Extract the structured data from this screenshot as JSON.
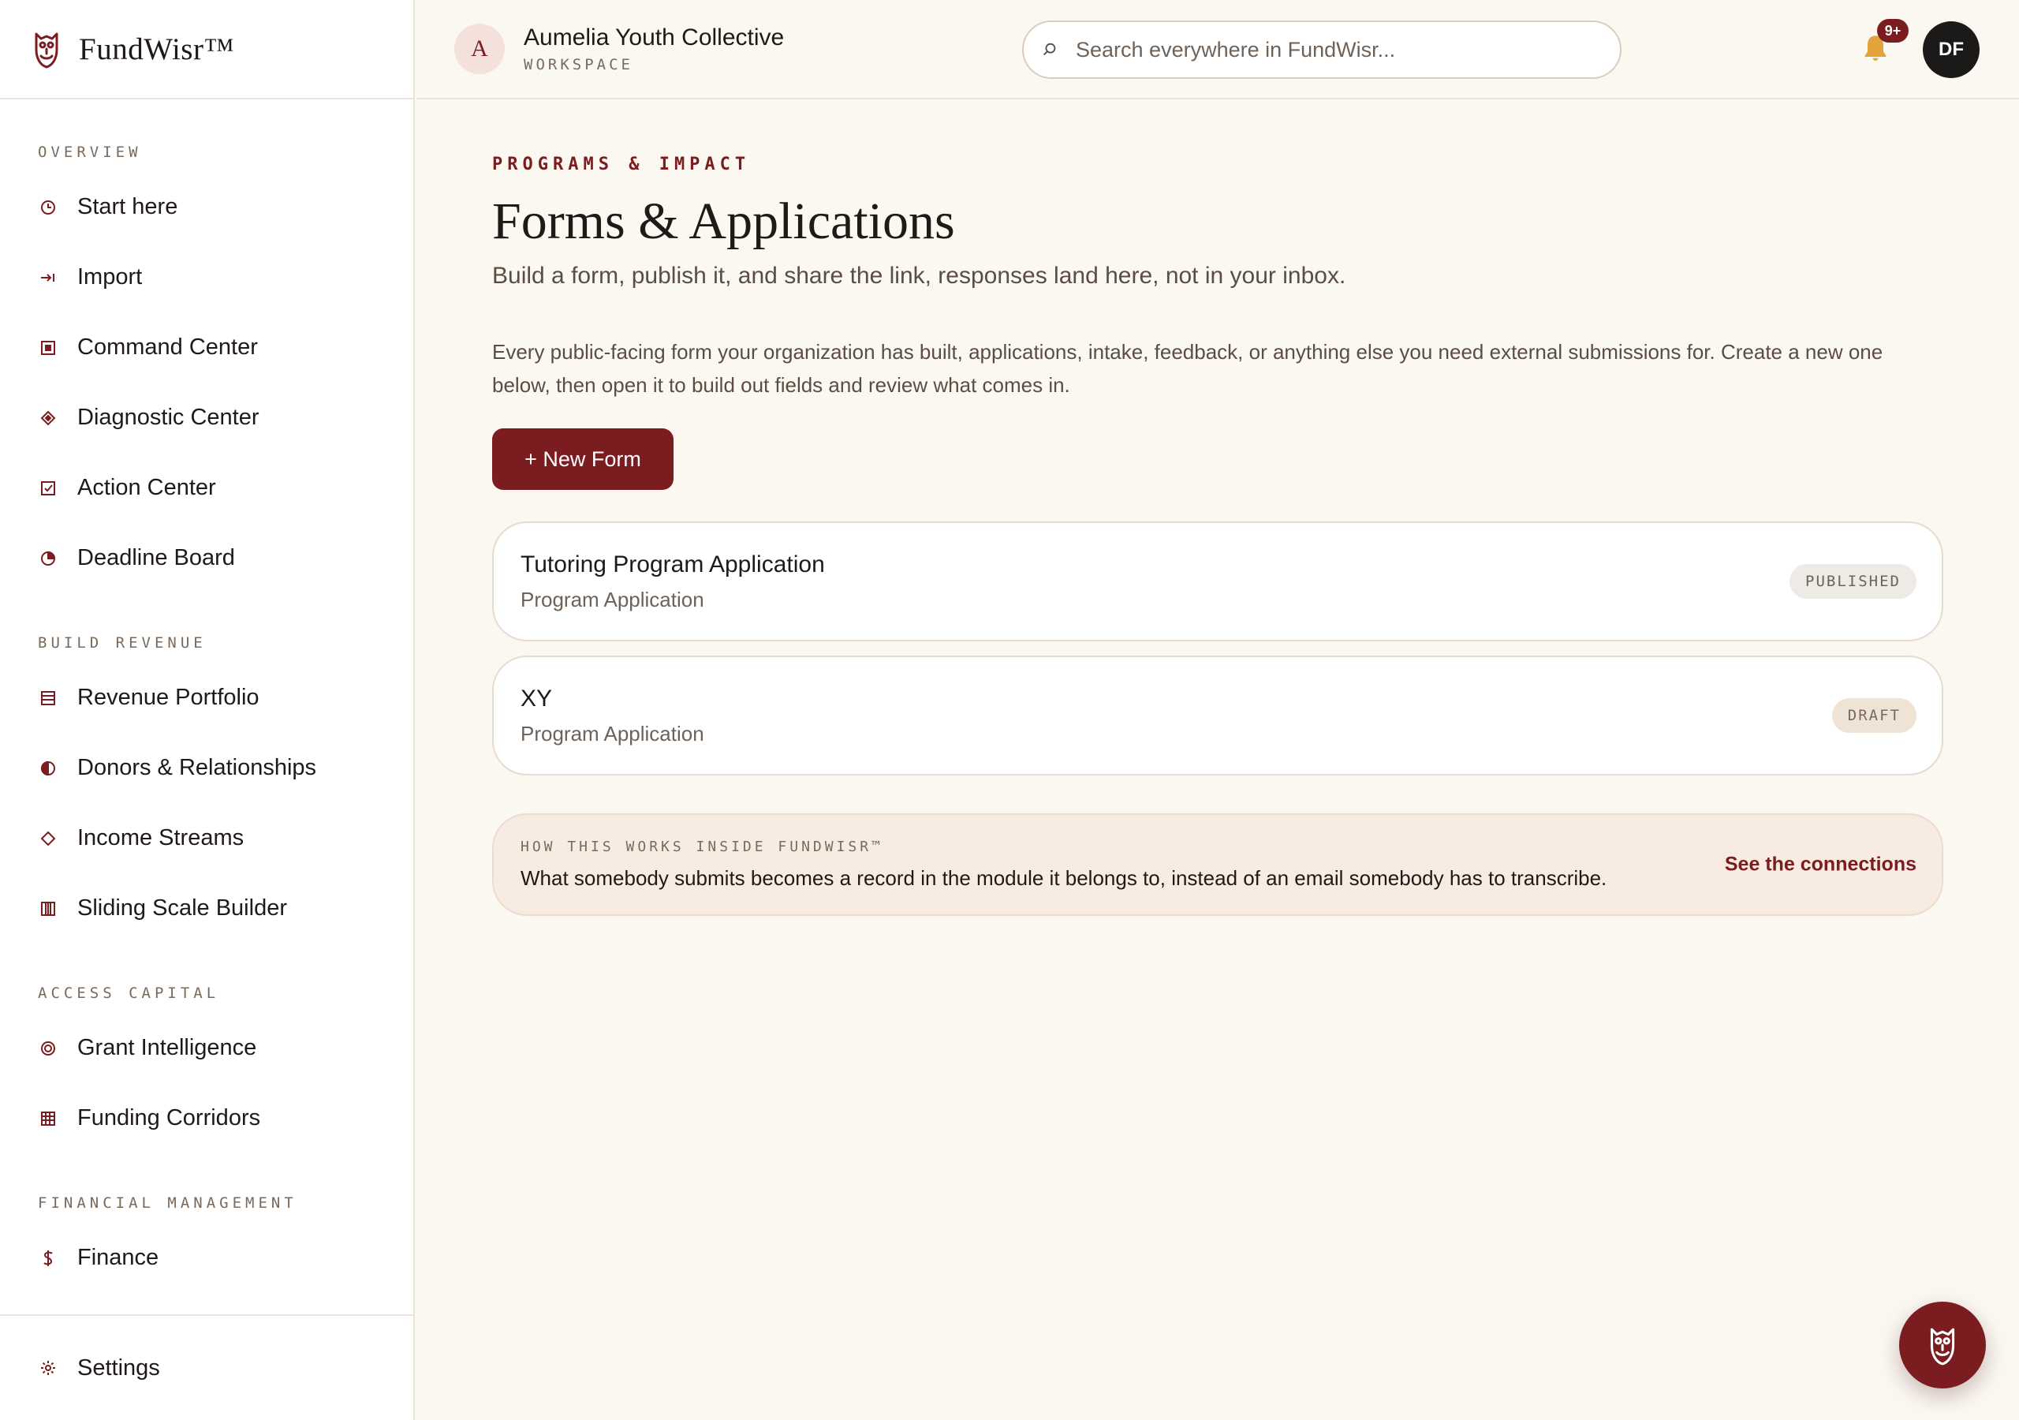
{
  "brand": {
    "name": "FundWisr™"
  },
  "workspace": {
    "initial": "A",
    "name": "Aumelia Youth Collective",
    "label": "WORKSPACE"
  },
  "search": {
    "placeholder": "Search everywhere in FundWisr..."
  },
  "notifications": {
    "badge": "9+"
  },
  "user": {
    "initials": "DF"
  },
  "sidebar": {
    "sections": [
      {
        "title": "OVERVIEW",
        "items": [
          {
            "label": "Start here",
            "icon": "clock-icon"
          },
          {
            "label": "Import",
            "icon": "import-arrow-icon"
          },
          {
            "label": "Command Center",
            "icon": "square-target-icon"
          },
          {
            "label": "Diagnostic Center",
            "icon": "diamond-icon"
          },
          {
            "label": "Action Center",
            "icon": "checkbox-icon"
          },
          {
            "label": "Deadline Board",
            "icon": "pie-icon"
          }
        ]
      },
      {
        "title": "BUILD REVENUE",
        "items": [
          {
            "label": "Revenue Portfolio",
            "icon": "list-icon"
          },
          {
            "label": "Donors & Relationships",
            "icon": "half-circle-icon"
          },
          {
            "label": "Income Streams",
            "icon": "diamond-outline-icon"
          },
          {
            "label": "Sliding Scale Builder",
            "icon": "columns-icon"
          }
        ]
      },
      {
        "title": "ACCESS CAPITAL",
        "items": [
          {
            "label": "Grant Intelligence",
            "icon": "target-icon"
          },
          {
            "label": "Funding Corridors",
            "icon": "grid-icon"
          }
        ]
      },
      {
        "title": "FINANCIAL MANAGEMENT",
        "items": [
          {
            "label": "Finance",
            "icon": "dollar-icon"
          }
        ]
      }
    ],
    "settings": {
      "label": "Settings",
      "icon": "gear-icon"
    }
  },
  "page": {
    "eyebrow": "PROGRAMS & IMPACT",
    "title": "Forms & Applications",
    "subtitle": "Build a form, publish it, and share the link, responses land here, not in your inbox.",
    "intro": "Every public-facing form your organization has built, applications, intake, feedback, or anything else you need external submissions for. Create a new one below, then open it to build out fields and review what comes in.",
    "new_button": "+ New Form"
  },
  "forms": [
    {
      "title": "Tutoring Program Application",
      "type": "Program Application",
      "status": "PUBLISHED"
    },
    {
      "title": "XY",
      "type": "Program Application",
      "status": "DRAFT"
    }
  ],
  "info": {
    "eyebrow": "HOW THIS WORKS INSIDE FUNDWISR™",
    "text": "What somebody submits becomes a record in the module it belongs to, instead of an email somebody has to transcribe.",
    "link": "See the connections"
  },
  "colors": {
    "accent": "#7a1c20",
    "background": "#fbf8f2",
    "bell": "#e3a23b"
  }
}
